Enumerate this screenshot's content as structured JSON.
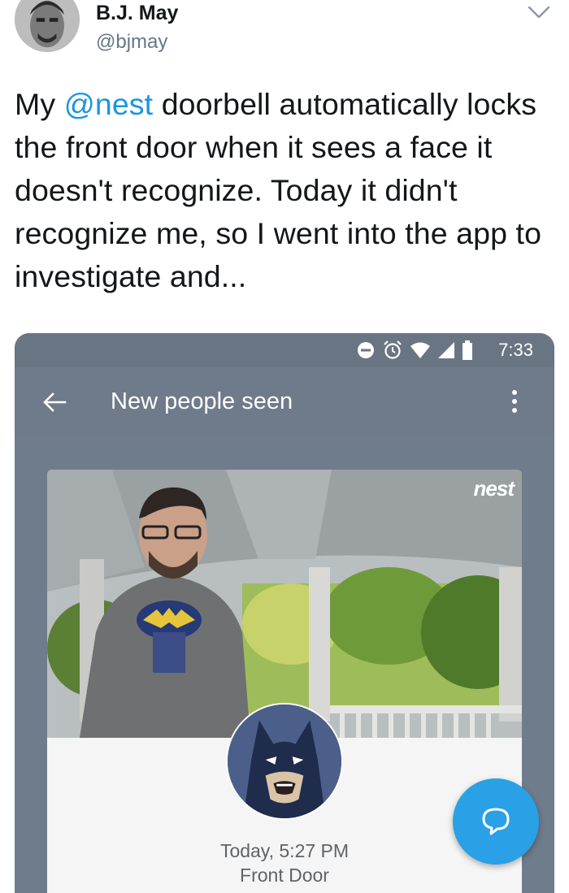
{
  "tweet": {
    "author_name": "B.J. May",
    "author_handle": "@bjmay",
    "text_before": "My ",
    "mention": "@nest",
    "text_after": " doorbell automatically locks the front door when it sees a face it doesn't recognize. Today it didn't recognize me, so I went into the app to investigate and..."
  },
  "app_screenshot": {
    "status_bar": {
      "time": "7:33",
      "icons": [
        "minus-circle-icon",
        "alarm-icon",
        "wifi-icon",
        "signal-icon",
        "battery-icon"
      ]
    },
    "app_bar": {
      "title": "New people seen",
      "back_icon": "arrow-left-icon",
      "menu_icon": "overflow-menu-icon"
    },
    "camera": {
      "logo": "nest"
    },
    "event": {
      "time": "Today, 5:27 PM",
      "location": "Front Door"
    },
    "fab_icon": "chat-bubble-icon"
  },
  "colors": {
    "mention": "#1b95e0",
    "app_bar": "#6f7b8b",
    "fab": "#2aa0e6"
  }
}
